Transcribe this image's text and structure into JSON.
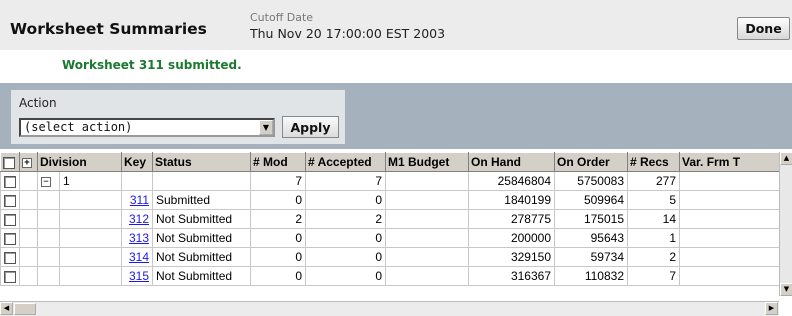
{
  "header": {
    "title": "Worksheet Summaries",
    "cutoff_label": "Cutoff Date",
    "cutoff_value": "Thu Nov 20 17:00:00 EST 2003",
    "done_label": "Done"
  },
  "message": "Worksheet 311 submitted.",
  "action": {
    "label": "Action",
    "selected": "(select action)",
    "apply_label": "Apply"
  },
  "grid": {
    "columns": [
      "Division",
      "Key",
      "Status",
      "# Mod",
      "# Accepted",
      "M1 Budget",
      "On Hand",
      "On Order",
      "# Recs",
      "Var. Frm T"
    ],
    "group": {
      "division": "1",
      "mod": "7",
      "accepted": "7",
      "budget": "",
      "on_hand": "25846804",
      "on_order": "5750083",
      "recs": "277"
    },
    "rows": [
      {
        "key": "311",
        "status": "Submitted",
        "mod": "0",
        "accepted": "0",
        "budget": "",
        "on_hand": "1840199",
        "on_order": "509964",
        "recs": "5"
      },
      {
        "key": "312",
        "status": "Not Submitted",
        "mod": "2",
        "accepted": "2",
        "budget": "",
        "on_hand": "278775",
        "on_order": "175015",
        "recs": "14"
      },
      {
        "key": "313",
        "status": "Not Submitted",
        "mod": "0",
        "accepted": "0",
        "budget": "",
        "on_hand": "200000",
        "on_order": "95643",
        "recs": "1"
      },
      {
        "key": "314",
        "status": "Not Submitted",
        "mod": "0",
        "accepted": "0",
        "budget": "",
        "on_hand": "329150",
        "on_order": "59734",
        "recs": "2"
      },
      {
        "key": "315",
        "status": "Not Submitted",
        "mod": "0",
        "accepted": "0",
        "budget": "",
        "on_hand": "316367",
        "on_order": "110832",
        "recs": "7"
      }
    ]
  },
  "icons": {
    "expand_all": "plus-box-icon",
    "collapse": "minus-box-icon",
    "scroll_up": "arrow-up-icon",
    "scroll_down": "arrow-down-icon",
    "scroll_left": "arrow-left-icon",
    "scroll_right": "arrow-right-icon"
  },
  "colors": {
    "message": "#1b7a2f",
    "action_bar": "#a5b1bd",
    "link": "#1a1aee"
  }
}
